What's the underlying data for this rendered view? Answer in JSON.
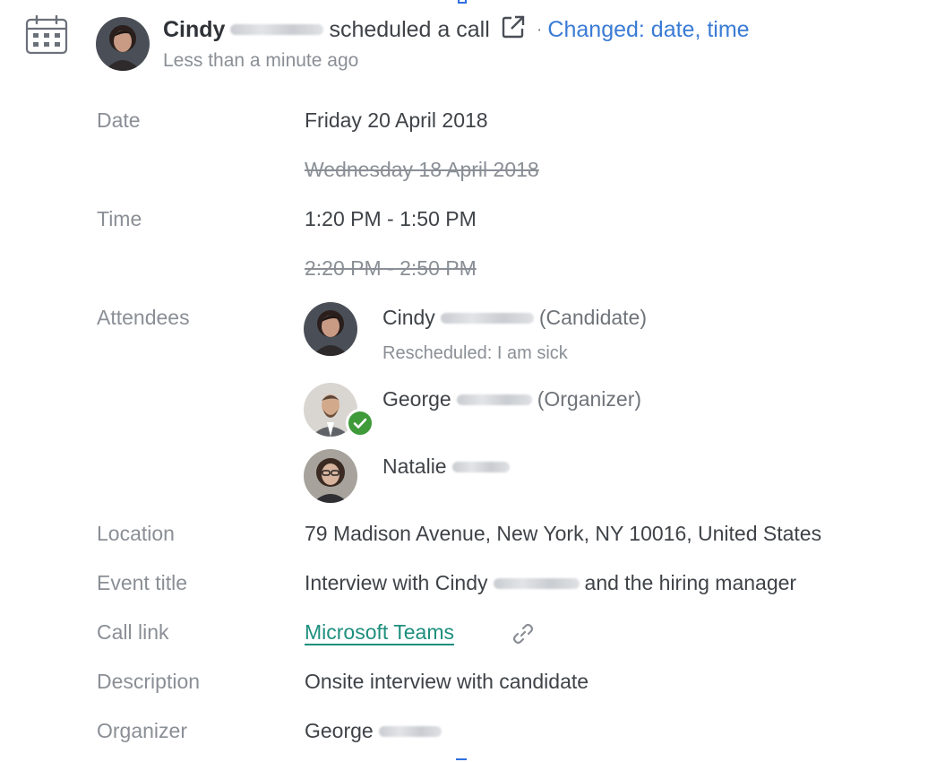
{
  "activity": {
    "actor_first_name": "Cindy",
    "action": "scheduled a",
    "object": "call",
    "separator": "·",
    "changed_text": "Changed: date, time",
    "timestamp": "Less than a minute ago"
  },
  "details": {
    "date_label": "Date",
    "date_new": "Friday 20 April 2018",
    "date_old": "Wednesday 18 April 2018",
    "time_label": "Time",
    "time_new": "1:20 PM - 1:50 PM",
    "time_old": "2:20 PM - 2:50 PM",
    "attendees_label": "Attendees",
    "location_label": "Location",
    "location": "79 Madison Avenue, New York, NY 10016, United States",
    "event_title_label": "Event title",
    "event_title_prefix": "Interview with Cindy",
    "event_title_suffix": "and the hiring manager",
    "call_link_label": "Call link",
    "call_link_text": "Microsoft Teams",
    "description_label": "Description",
    "description": "Onsite interview with candidate",
    "organizer_label": "Organizer",
    "organizer_first_name": "George"
  },
  "attendees": [
    {
      "first_name": "Cindy",
      "role": "(Candidate)",
      "note": "Rescheduled: I am sick"
    },
    {
      "first_name": "George",
      "role": "(Organizer)",
      "status": "accepted"
    },
    {
      "first_name": "Natalie",
      "role": ""
    }
  ],
  "icons": {
    "calendar": "calendar-icon",
    "external_link": "external-link-icon",
    "link": "link-icon",
    "accepted": "check-badge-icon"
  },
  "colors": {
    "changed_blue": "#3a7bd5",
    "link_teal": "#1e8f7e",
    "accepted_green": "#3f9a3a",
    "muted_text": "#8a8f96"
  }
}
